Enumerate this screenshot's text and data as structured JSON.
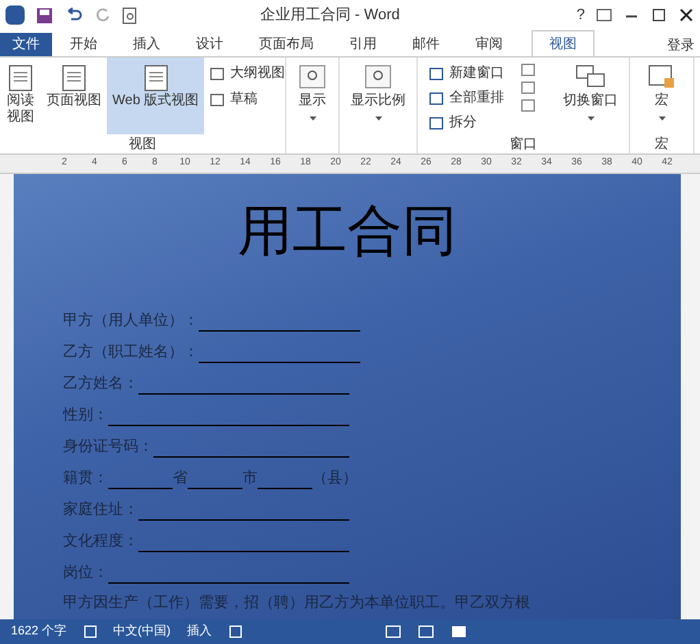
{
  "window": {
    "title": "企业用工合同 - Word",
    "help": "?"
  },
  "tabs": [
    {
      "label": "文件",
      "kind": "file",
      "selected": false
    },
    {
      "label": "开始",
      "kind": "tab",
      "selected": false
    },
    {
      "label": "插入",
      "kind": "tab",
      "selected": false
    },
    {
      "label": "设计",
      "kind": "tab",
      "selected": false
    },
    {
      "label": "页面布局",
      "kind": "tab",
      "selected": false
    },
    {
      "label": "引用",
      "kind": "tab",
      "selected": false
    },
    {
      "label": "邮件",
      "kind": "tab",
      "selected": false
    },
    {
      "label": "审阅",
      "kind": "tab",
      "selected": false
    },
    {
      "label": "视图",
      "kind": "tab",
      "selected": true
    }
  ],
  "account": "登录",
  "ribbon": {
    "views": {
      "label": "视图",
      "large": [
        {
          "label": "阅读视图",
          "selected": false
        },
        {
          "label": "页面视图",
          "selected": false
        },
        {
          "label": "Web 版式视图",
          "selected": true
        }
      ],
      "small": [
        "大纲视图",
        "草稿"
      ]
    },
    "show": "显示",
    "zoom": "显示比例",
    "window": {
      "label": "窗口",
      "small": [
        "新建窗口",
        "全部重排",
        "拆分"
      ],
      "switch": "切换窗口"
    },
    "macro": {
      "button": "宏",
      "label": "宏"
    }
  },
  "ruler": [
    "2",
    "4",
    "6",
    "8",
    "10",
    "12",
    "14",
    "16",
    "18",
    "20",
    "22",
    "24",
    "26",
    "28",
    "30",
    "32",
    "34",
    "36",
    "38",
    "40",
    "42"
  ],
  "document": {
    "title": "用工合同",
    "fields": [
      {
        "kind": "line",
        "label": "甲方（用人单位）："
      },
      {
        "kind": "line",
        "label": "乙方（职工姓名）："
      },
      {
        "kind": "line",
        "label": "乙方姓名："
      },
      {
        "kind": "line",
        "label": "性别："
      },
      {
        "kind": "line",
        "label": "身份证号码："
      },
      {
        "kind": "segments",
        "label": "籍贯：",
        "segments": [
          "省",
          "市",
          "（县）"
        ]
      },
      {
        "kind": "line",
        "label": "家庭住址："
      },
      {
        "kind": "line",
        "label": "文化程度："
      },
      {
        "kind": "line",
        "label": "岗位："
      }
    ],
    "paragraph": "甲方因生产（工作）需要，招（聘）用乙方为本单位职工。甲乙双方根"
  },
  "status_bar": {
    "words": "1622 个字",
    "language": "中文(中国)",
    "mode": "插入"
  }
}
